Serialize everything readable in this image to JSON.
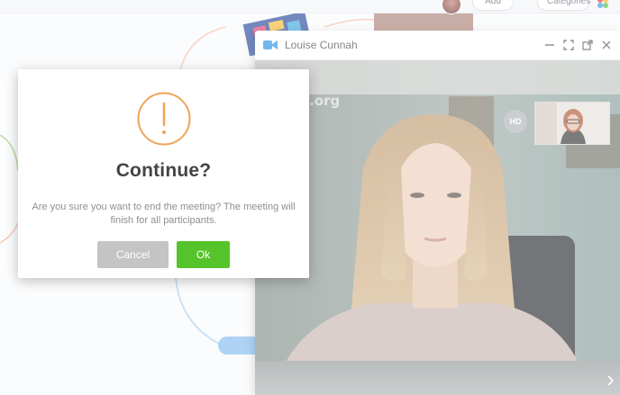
{
  "header": {
    "add_label": "Add",
    "categories_label": "Categories"
  },
  "video_window": {
    "title": "Louise Cunnah",
    "watermark": "si.org",
    "hd_badge": "HD",
    "icons": [
      "video-camera-icon",
      "minimize-icon",
      "fullscreen-icon",
      "popout-icon",
      "close-icon",
      "chevron-right-icon"
    ]
  },
  "dialog": {
    "title": "Continue?",
    "message": "Are you sure you want to end the meeting? The meeting will finish for all participants.",
    "cancel_label": "Cancel",
    "ok_label": "Ok",
    "icon": "warning-icon"
  },
  "colors": {
    "warning_orange": "#f0a458",
    "ok_green": "#55c42a",
    "cancel_gray": "#c4c4c4",
    "camera_blue": "#3d9be9"
  }
}
